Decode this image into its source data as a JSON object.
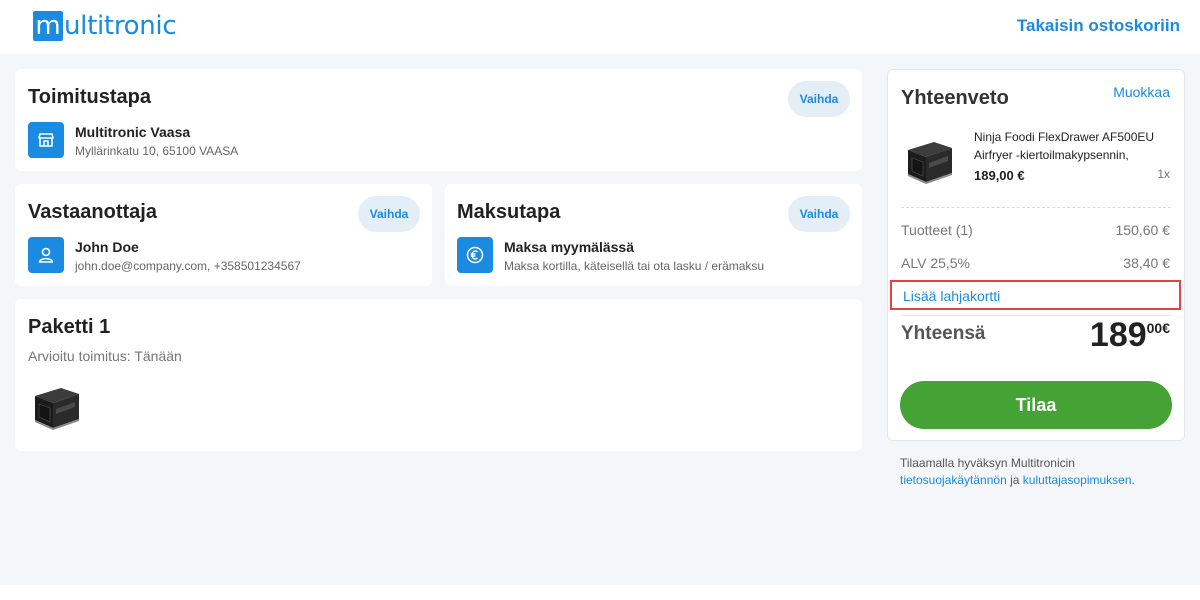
{
  "header": {
    "logo_first": "m",
    "logo_rest": "ultitronic",
    "back_link": "Takaisin ostoskoriin"
  },
  "delivery": {
    "title": "Toimitustapa",
    "change": "Vaihda",
    "store_name": "Multitronic Vaasa",
    "address": "Myllärinkatu 10, 65100 VAASA"
  },
  "recipient": {
    "title": "Vastaanottaja",
    "change": "Vaihda",
    "name": "John Doe",
    "contact": "john.doe@company.com, +358501234567"
  },
  "payment": {
    "title": "Maksutapa",
    "change": "Vaihda",
    "method": "Maksa myymälässä",
    "description": "Maksa kortilla, käteisellä tai ota lasku / erämaksu"
  },
  "package": {
    "title": "Paketti 1",
    "estimate": "Arvioitu toimitus: Tänään"
  },
  "summary": {
    "title": "Yhteenveto",
    "edit": "Muokkaa",
    "product_name": "Ninja Foodi FlexDrawer AF500EU Airfryer -kiertoilmakypsennin,",
    "product_price": "189,00 €",
    "product_qty": "1x",
    "products_label": "Tuotteet (1)",
    "products_value": "150,60 €",
    "vat_label": "ALV 25,5%",
    "vat_value": "38,40 €",
    "gift_card": "Lisää lahjakortti",
    "total_label": "Yhteensä",
    "total_int": "189",
    "total_dec": "00€",
    "order_button": "Tilaa"
  },
  "terms": {
    "text_before": "Tilaamalla hyväksyn Multitronicin",
    "link_privacy": "tietosuojakäytännön",
    "text_and": "ja",
    "link_consumer": "kuluttajasopimuksen."
  },
  "colors": {
    "brand_blue": "#1a8be0",
    "order_green": "#45a235",
    "highlight_red": "#e04444"
  }
}
